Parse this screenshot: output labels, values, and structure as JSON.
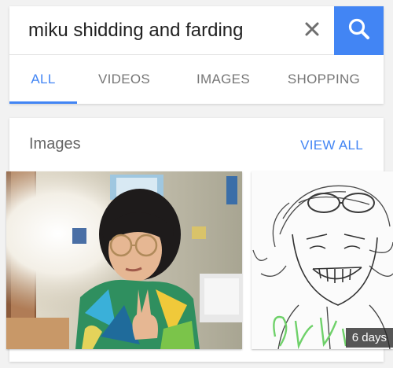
{
  "search": {
    "query": "miku shidding and farding"
  },
  "tabs": [
    {
      "label": "ALL",
      "active": true
    },
    {
      "label": "VIDEOS",
      "active": false
    },
    {
      "label": "IMAGES",
      "active": false
    },
    {
      "label": "SHOPPING",
      "active": false
    }
  ],
  "images_section": {
    "title": "Images",
    "view_all_label": "VIEW ALL",
    "results": [
      {
        "kind": "photo"
      },
      {
        "kind": "sketch",
        "age": "6 days"
      }
    ]
  },
  "colors": {
    "accent": "#4285f4",
    "background": "#f2f2f2",
    "tab_inactive": "#757575"
  },
  "icons": {
    "clear": "close-icon",
    "search": "search-icon"
  }
}
